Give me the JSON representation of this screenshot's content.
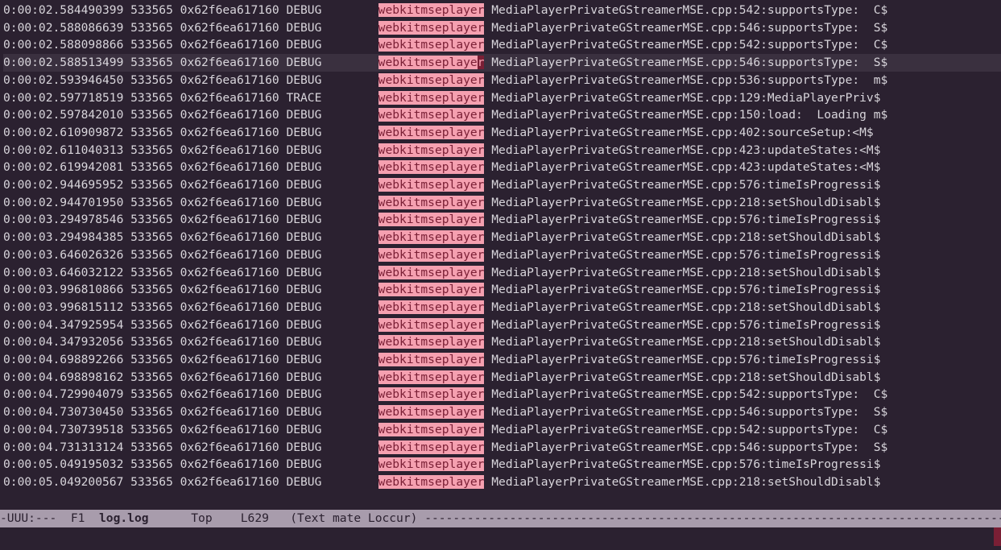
{
  "colors": {
    "bg": "#2b2130",
    "fg": "#d8d5db",
    "hl_bg": "#f5a0b0",
    "hl_fg": "#7a1f35",
    "modeline_bg": "#a89cac"
  },
  "highlight_token": "webkitmseplayer",
  "current_line_index": 3,
  "modeline": {
    "left": "-UUU:---  F1  ",
    "buffer": "log.log",
    "mid": "      Top    L629   (Text mate Loccur) ",
    "dashes": "------------------------------------------------------------------------------------------"
  },
  "cols": {
    "pid": "533565",
    "addr": "0x62f6ea617160",
    "pad_before_hl": "        ",
    "file": "MediaPlayerPrivateGStreamerMSE.cpp"
  },
  "lines": [
    {
      "ts": "0:00:02.584490399",
      "lvl": "DEBUG",
      "loc": "542",
      "fn": "supportsType",
      "tail": "C$"
    },
    {
      "ts": "0:00:02.588086639",
      "lvl": "DEBUG",
      "loc": "546",
      "fn": "supportsType",
      "tail": "S$"
    },
    {
      "ts": "0:00:02.588098866",
      "lvl": "DEBUG",
      "loc": "542",
      "fn": "supportsType",
      "tail": "C$"
    },
    {
      "ts": "0:00:02.588513499",
      "lvl": "DEBUG",
      "loc": "546",
      "fn": "supportsType",
      "tail": "S$"
    },
    {
      "ts": "0:00:02.593946450",
      "lvl": "DEBUG",
      "loc": "536",
      "fn": "supportsType",
      "tail": "m$"
    },
    {
      "ts": "0:00:02.597718519",
      "lvl": "TRACE",
      "loc": "129",
      "fn": "MediaPlayerPriv",
      "tail": "$",
      "nocolon": true
    },
    {
      "ts": "0:00:02.597842010",
      "lvl": "DEBUG",
      "loc": "150",
      "fn": "load",
      "tail": "Loading m$"
    },
    {
      "ts": "0:00:02.610909872",
      "lvl": "DEBUG",
      "loc": "402",
      "fn": "sourceSetup",
      "tail": "<M$",
      "nosp": true
    },
    {
      "ts": "0:00:02.611040313",
      "lvl": "DEBUG",
      "loc": "423",
      "fn": "updateStates",
      "tail": "<M$",
      "nosp": true
    },
    {
      "ts": "0:00:02.619942081",
      "lvl": "DEBUG",
      "loc": "423",
      "fn": "updateStates",
      "tail": "<M$",
      "nosp": true
    },
    {
      "ts": "0:00:02.944695952",
      "lvl": "DEBUG",
      "loc": "576",
      "fn": "timeIsProgressi",
      "tail": "$",
      "nocolon": true
    },
    {
      "ts": "0:00:02.944701950",
      "lvl": "DEBUG",
      "loc": "218",
      "fn": "setShouldDisabl",
      "tail": "$",
      "nocolon": true
    },
    {
      "ts": "0:00:03.294978546",
      "lvl": "DEBUG",
      "loc": "576",
      "fn": "timeIsProgressi",
      "tail": "$",
      "nocolon": true
    },
    {
      "ts": "0:00:03.294984385",
      "lvl": "DEBUG",
      "loc": "218",
      "fn": "setShouldDisabl",
      "tail": "$",
      "nocolon": true
    },
    {
      "ts": "0:00:03.646026326",
      "lvl": "DEBUG",
      "loc": "576",
      "fn": "timeIsProgressi",
      "tail": "$",
      "nocolon": true
    },
    {
      "ts": "0:00:03.646032122",
      "lvl": "DEBUG",
      "loc": "218",
      "fn": "setShouldDisabl",
      "tail": "$",
      "nocolon": true
    },
    {
      "ts": "0:00:03.996810866",
      "lvl": "DEBUG",
      "loc": "576",
      "fn": "timeIsProgressi",
      "tail": "$",
      "nocolon": true
    },
    {
      "ts": "0:00:03.996815112",
      "lvl": "DEBUG",
      "loc": "218",
      "fn": "setShouldDisabl",
      "tail": "$",
      "nocolon": true
    },
    {
      "ts": "0:00:04.347925954",
      "lvl": "DEBUG",
      "loc": "576",
      "fn": "timeIsProgressi",
      "tail": "$",
      "nocolon": true
    },
    {
      "ts": "0:00:04.347932056",
      "lvl": "DEBUG",
      "loc": "218",
      "fn": "setShouldDisabl",
      "tail": "$",
      "nocolon": true
    },
    {
      "ts": "0:00:04.698892266",
      "lvl": "DEBUG",
      "loc": "576",
      "fn": "timeIsProgressi",
      "tail": "$",
      "nocolon": true
    },
    {
      "ts": "0:00:04.698898162",
      "lvl": "DEBUG",
      "loc": "218",
      "fn": "setShouldDisabl",
      "tail": "$",
      "nocolon": true
    },
    {
      "ts": "0:00:04.729904079",
      "lvl": "DEBUG",
      "loc": "542",
      "fn": "supportsType",
      "tail": "C$"
    },
    {
      "ts": "0:00:04.730730450",
      "lvl": "DEBUG",
      "loc": "546",
      "fn": "supportsType",
      "tail": "S$"
    },
    {
      "ts": "0:00:04.730739518",
      "lvl": "DEBUG",
      "loc": "542",
      "fn": "supportsType",
      "tail": "C$"
    },
    {
      "ts": "0:00:04.731313124",
      "lvl": "DEBUG",
      "loc": "546",
      "fn": "supportsType",
      "tail": "S$"
    },
    {
      "ts": "0:00:05.049195032",
      "lvl": "DEBUG",
      "loc": "576",
      "fn": "timeIsProgressi",
      "tail": "$",
      "nocolon": true
    },
    {
      "ts": "0:00:05.049200567",
      "lvl": "DEBUG",
      "loc": "218",
      "fn": "setShouldDisabl",
      "tail": "$",
      "nocolon": true
    }
  ]
}
